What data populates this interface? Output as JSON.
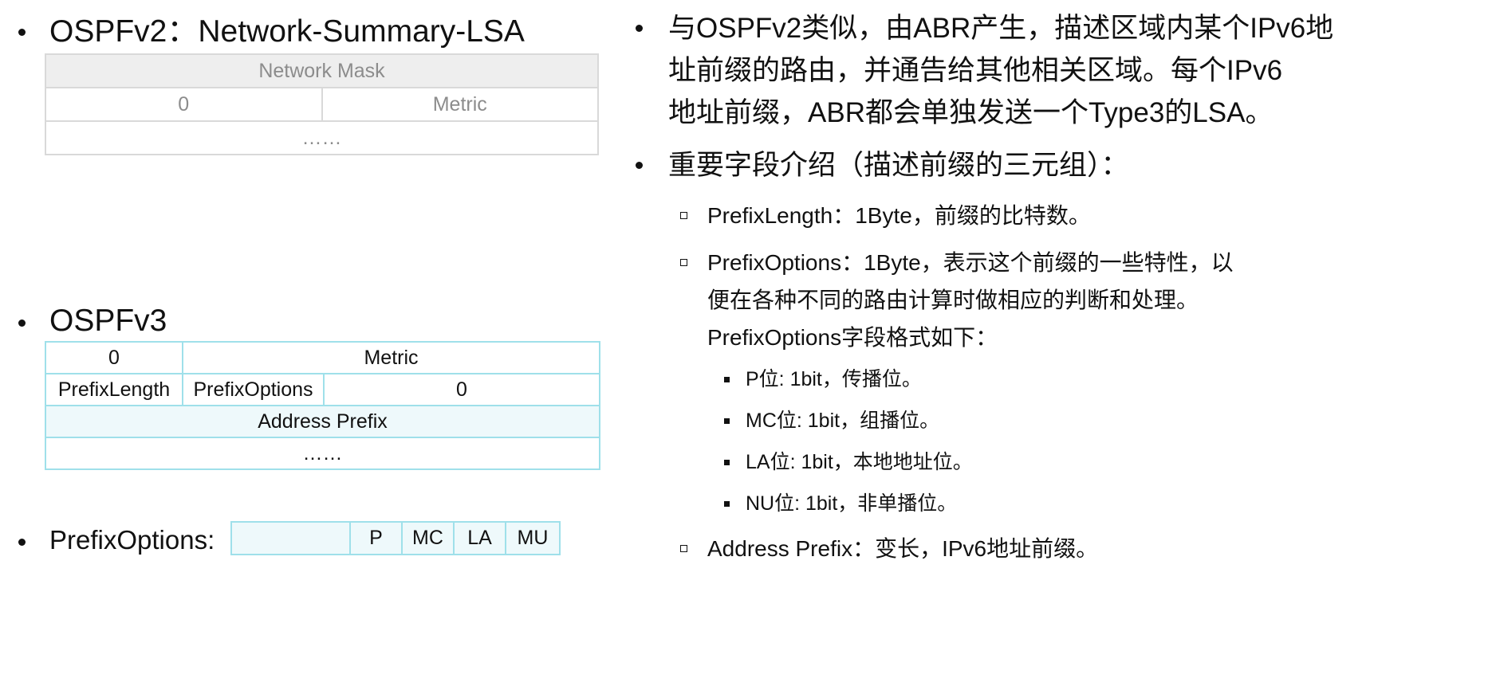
{
  "left": {
    "v2": {
      "heading": "OSPFv2：Network-Summary-LSA",
      "table": {
        "network_mask": "Network Mask",
        "zero": "0",
        "metric": "Metric",
        "ellipsis": "……"
      }
    },
    "v3": {
      "heading": "OSPFv3",
      "table": {
        "zero": "0",
        "metric": "Metric",
        "prefix_length": "PrefixLength",
        "prefix_options": "PrefixOptions",
        "zero2": "0",
        "address_prefix": "Address Prefix",
        "ellipsis": "……"
      }
    },
    "prefix_options": {
      "heading": "PrefixOptions:",
      "bits": [
        "",
        "P",
        "MC",
        "LA",
        "MU"
      ]
    }
  },
  "right": {
    "intro": {
      "lines": [
        "与OSPFv2类似，由ABR产生，描述区域内某个IPv6地",
        "址前缀的路由，并通告给其他相关区域。每个IPv6",
        "地址前缀，ABR都会单独发送一个Type3的LSA。"
      ]
    },
    "fields_heading": "重要字段介绍（描述前缀的三元组）：",
    "prefix_length": "PrefixLength：1Byte，前缀的比特数。",
    "prefix_options": {
      "lines": [
        "PrefixOptions：1Byte，表示这个前缀的一些特性，以",
        "便在各种不同的路由计算时做相应的判断和处理。",
        "PrefixOptions字段格式如下："
      ]
    },
    "bits": [
      "P位: 1bit，传播位。",
      "MC位: 1bit，组播位。",
      "LA位: 1bit，本地地址位。",
      "NU位: 1bit，非单播位。"
    ],
    "address_prefix": "Address Prefix：变长，IPv6地址前缀。"
  }
}
